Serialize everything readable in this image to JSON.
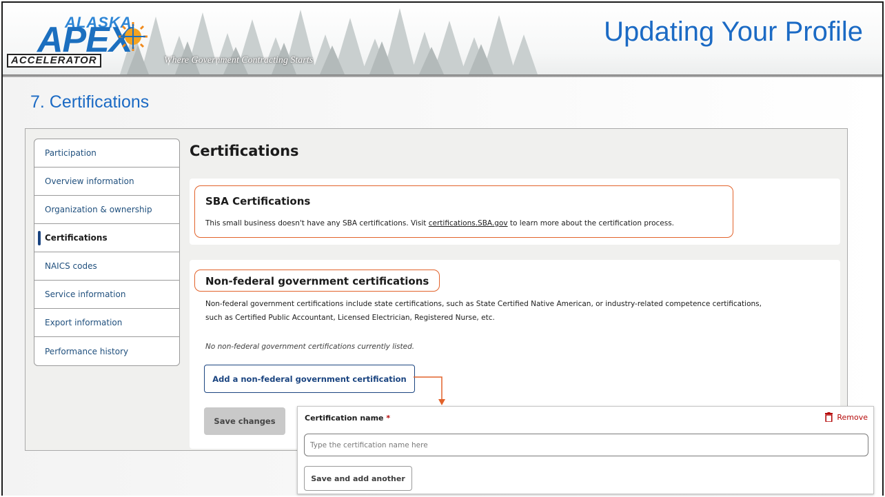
{
  "header": {
    "logo_top": "ALASKA",
    "logo_main": "APEX",
    "logo_bottom": "ACCELERATOR",
    "tagline": "Where Government Contracting Starts",
    "slide_title": "Updating Your Profile"
  },
  "section_heading": "7.  Certifications",
  "sidebar": {
    "items": [
      {
        "label": "Participation"
      },
      {
        "label": "Overview information"
      },
      {
        "label": "Organization & ownership"
      },
      {
        "label": "Certifications",
        "active": true
      },
      {
        "label": "NAICS codes"
      },
      {
        "label": "Service information"
      },
      {
        "label": "Export information"
      },
      {
        "label": "Performance history"
      }
    ]
  },
  "content": {
    "title": "Certifications",
    "sba": {
      "heading": "SBA Certifications",
      "text_before": "This small business doesn't have any SBA certifications. Visit ",
      "link": "certifications.SBA.gov",
      "text_after": " to learn more about the certification process."
    },
    "nonfederal": {
      "heading": "Non-federal government certifications",
      "description_line1": "Non-federal government certifications include state certifications, such as State Certified Native American, or industry-related competence certifications,",
      "description_line2": "such as Certified Public Accountant, Licensed Electrician, Registered Nurse, etc.",
      "empty_message": "No non-federal government certifications currently listed.",
      "add_button": "Add a non-federal government certification",
      "save_button": "Save changes"
    }
  },
  "popout": {
    "label": "Certification name",
    "required_mark": "*",
    "remove_label": "Remove",
    "input_placeholder": "Type the certification name here",
    "save_another_button": "Save and add another"
  },
  "colors": {
    "title_blue": "#1b6ac4",
    "highlight_orange": "#e2622a",
    "nav_link": "#1f4f7d",
    "primary_button": "#1a4480",
    "danger": "#b50909"
  }
}
